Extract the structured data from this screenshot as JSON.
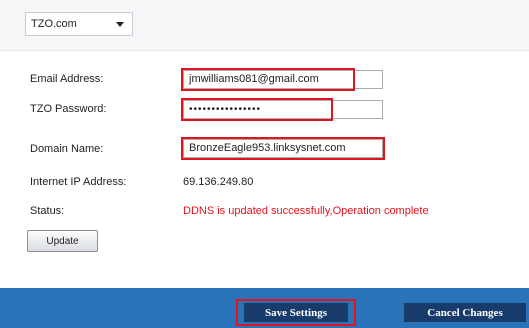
{
  "domain_select": {
    "value": "TZO.com"
  },
  "form": {
    "email_label": "Email Address:",
    "email_value": "jmwilliams081@gmail.com",
    "password_label": "TZO Password:",
    "password_value": "••••••••••••••••",
    "domain_label": "Domain Name:",
    "domain_value": "BronzeEagle953.linksysnet.com",
    "ip_label": "Internet IP Address:",
    "ip_value": "69.136.249.80",
    "status_label": "Status:",
    "status_value": "DDNS is updated successfully,Operation complete"
  },
  "buttons": {
    "update": "Update",
    "save": "Save Settings",
    "cancel": "Cancel Changes"
  },
  "colors": {
    "footer": "#2a73b8",
    "footer_button": "#173c6b",
    "highlight": "#e3121b",
    "status_text": "#e3121b"
  }
}
